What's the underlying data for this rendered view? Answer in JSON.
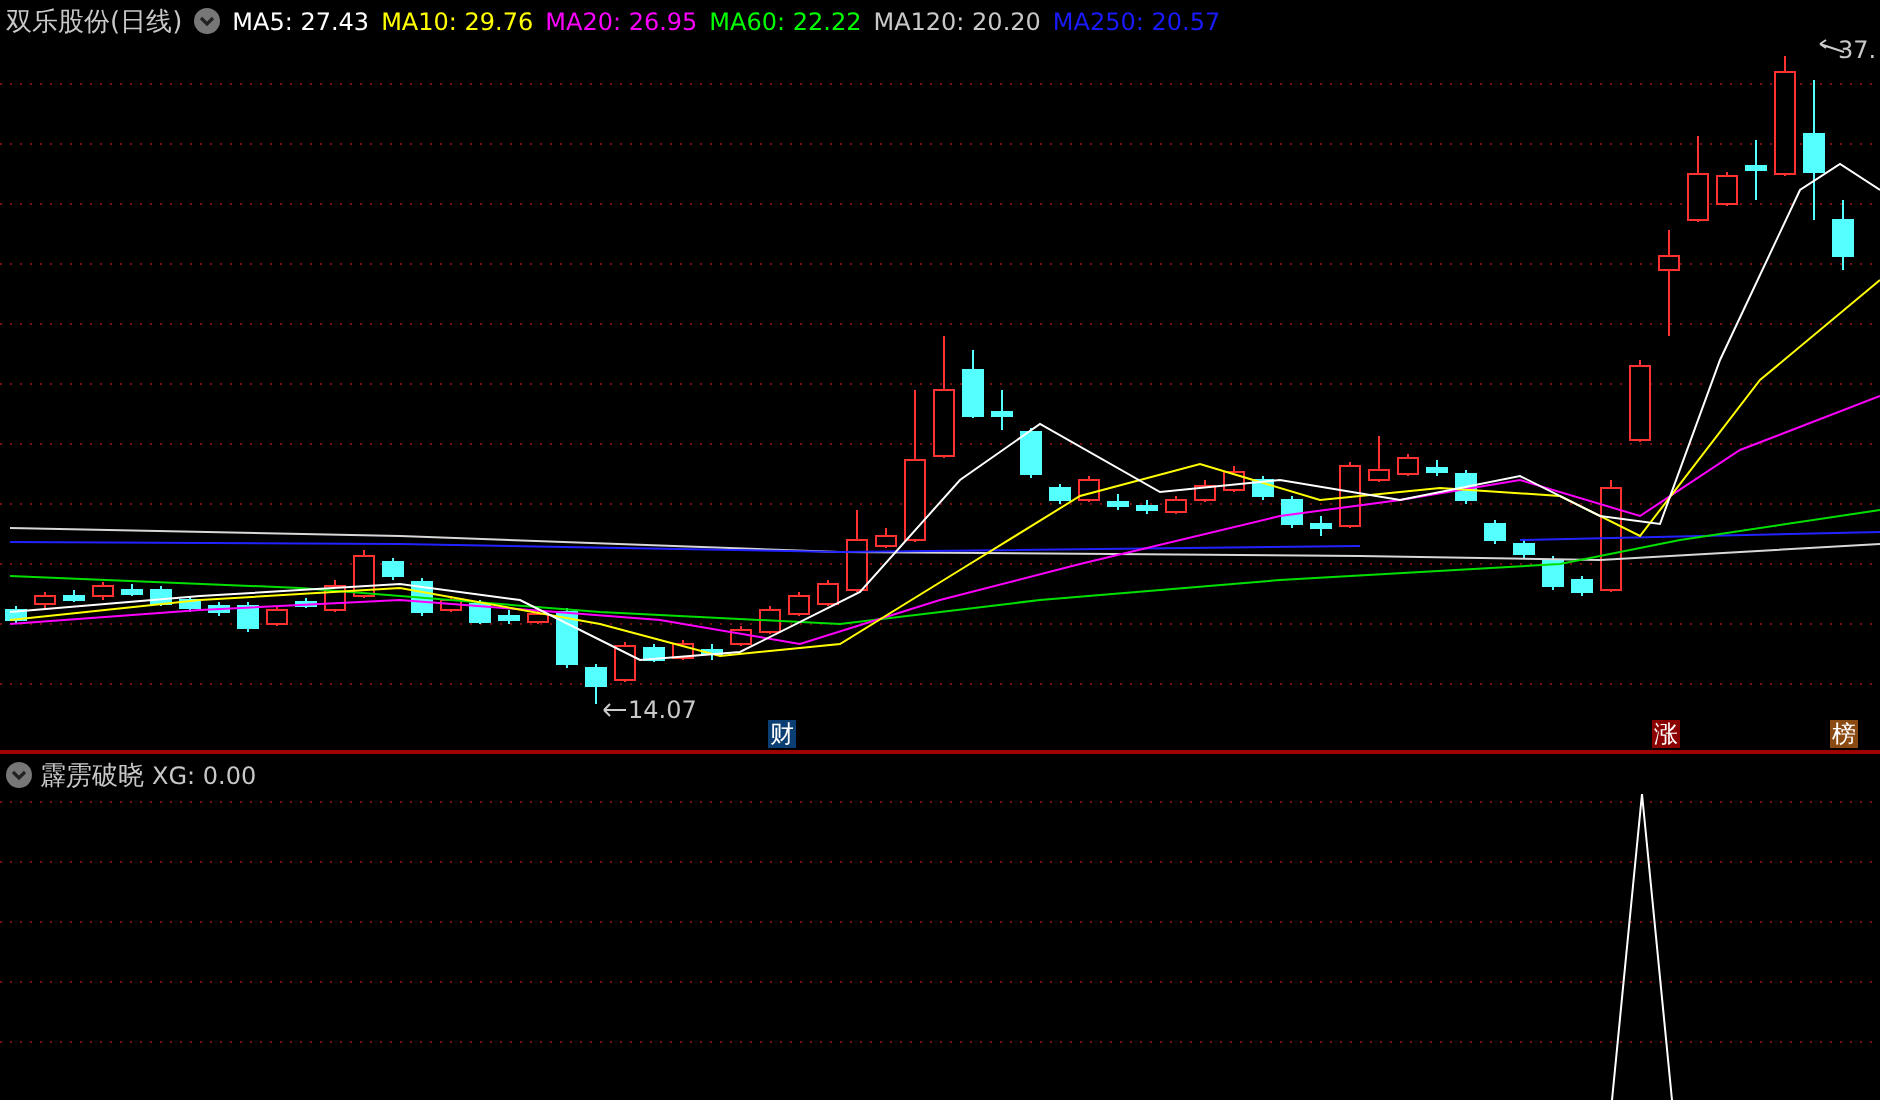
{
  "header": {
    "title": "双乐股份(日线)",
    "indicators": [
      {
        "label": "MA5: 27.43",
        "color": "#ffffff"
      },
      {
        "label": "MA10: 29.76",
        "color": "#ffff00"
      },
      {
        "label": "MA20: 26.95",
        "color": "#ff00ff"
      },
      {
        "label": "MA60: 22.22",
        "color": "#00ff00"
      },
      {
        "label": "MA120: 20.20",
        "color": "#c8c8c8"
      },
      {
        "label": "MA250: 20.57",
        "color": "#1a1aff"
      }
    ]
  },
  "main_chart": {
    "high_label": "37.",
    "low_label": "14.07",
    "markers": [
      {
        "text": "财",
        "color": "#0b3f73"
      },
      {
        "text": "涨",
        "color": "#8b0000"
      },
      {
        "text": "榜",
        "color": "#8b4a12"
      }
    ]
  },
  "indicator_panel": {
    "title": "霹雳破晓",
    "reading": "XG: 0.00"
  }
}
